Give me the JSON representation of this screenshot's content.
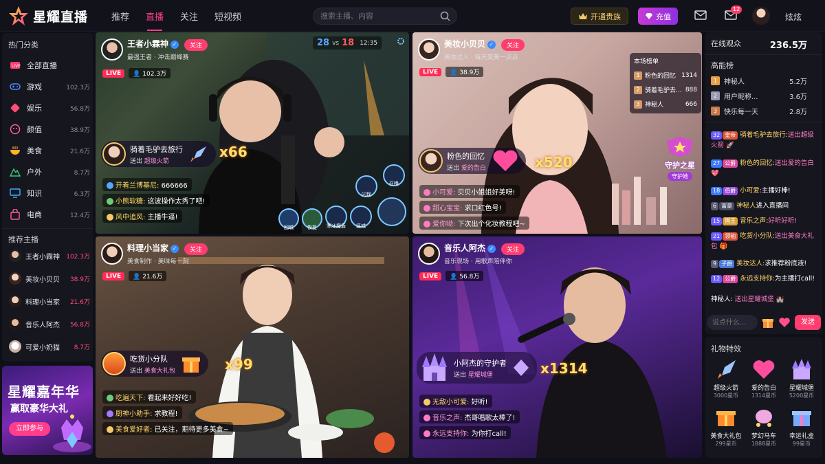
{
  "app": {
    "name": "星耀直播"
  },
  "nav": [
    "推荐",
    "直播",
    "关注",
    "短视频"
  ],
  "search": {
    "placeholder": "搜索主播、内容"
  },
  "header": {
    "vip_label": "开通贵族",
    "charge_label": "充值",
    "message_badge": "12",
    "username": "炫炫"
  },
  "sidebar": {
    "categories_title": "热门分类",
    "categories": [
      {
        "name": "全部直播",
        "count": "",
        "icon": "live-tv-icon",
        "color": "#ff3d6e"
      },
      {
        "name": "游戏",
        "count": "102.3万",
        "icon": "gamepad-icon",
        "color": "#4d8bff"
      },
      {
        "name": "娱乐",
        "count": "56.8万",
        "icon": "ticket-icon",
        "color": "#ff4d79"
      },
      {
        "name": "颜值",
        "count": "38.9万",
        "icon": "face-icon",
        "color": "#ff5fa2"
      },
      {
        "name": "美食",
        "count": "21.6万",
        "icon": "bowl-icon",
        "color": "#ffb020"
      },
      {
        "name": "户外",
        "count": "8.7万",
        "icon": "mountain-icon",
        "color": "#39c97a"
      },
      {
        "name": "知识",
        "count": "6.3万",
        "icon": "monitor-icon",
        "color": "#3ab0ff"
      },
      {
        "name": "电商",
        "count": "12.4万",
        "icon": "shopping-bag-icon",
        "color": "#ff5fa2"
      }
    ],
    "recommend_title": "推荐主播",
    "recommend": [
      {
        "name": "王者小霖神",
        "count": "102.3万"
      },
      {
        "name": "美妆小贝贝",
        "count": "38.9万"
      },
      {
        "name": "料理小当家",
        "count": "21.6万"
      },
      {
        "name": "音乐人阿杰",
        "count": "56.8万"
      },
      {
        "name": "可爱小奶猫",
        "count": "8.7万"
      }
    ]
  },
  "ad": {
    "title": "星耀嘉年华",
    "subtitle": "赢取豪华大礼",
    "button": "立即参与"
  },
  "streams": [
    {
      "name": "王者小霖神",
      "sub": "最强王者 · 冲击巅峰赛",
      "follow": "关注",
      "live": "LIVE",
      "viewers": "102.3万",
      "hud": {
        "score_left": "28",
        "vs": "vs",
        "score_right": "18",
        "time": "12:35"
      },
      "skills": [
        "回城",
        "恢复",
        "寒冰魔盾",
        "惩戒",
        "闪现",
        "召唤"
      ],
      "gift": {
        "user": "骑着毛驴去旅行",
        "action": "送出",
        "item": "超级火箭",
        "mult": "x66"
      },
      "chat": [
        {
          "u": "开着兰博基尼:",
          "t": "666666"
        },
        {
          "u": "小熊软糖:",
          "t": "这波操作太秀了吧!"
        },
        {
          "u": "风中追风:",
          "t": "主播牛逼!"
        }
      ]
    },
    {
      "name": "美妆小贝贝",
      "sub": "美妆达人 · 每天变美一点点",
      "follow": "关注",
      "live": "LIVE",
      "viewers": "38.9万",
      "rank": {
        "title": "本场榜单",
        "rows": [
          {
            "n": "1",
            "name": "粉色的回忆",
            "v": "1314"
          },
          {
            "n": "2",
            "name": "骑着毛驴去...",
            "v": "888"
          },
          {
            "n": "3",
            "name": "神秘人",
            "v": "666"
          }
        ]
      },
      "guard": {
        "title": "守护之星",
        "button": "守护她"
      },
      "gift": {
        "user": "粉色的回忆",
        "action": "送出",
        "item": "爱的告白",
        "mult": "x520"
      },
      "chat": [
        {
          "u": "小可爱:",
          "t": "贝贝小姐姐好美呀!"
        },
        {
          "u": "甜心宝宝:",
          "t": "求口红色号!"
        },
        {
          "u": "爱你呦:",
          "t": "下次出个化妆教程吧~"
        }
      ]
    },
    {
      "name": "料理小当家",
      "sub": "美食制作 · 美味每一刻",
      "follow": "关注",
      "live": "LIVE",
      "viewers": "21.6万",
      "gift": {
        "user": "吃货小分队",
        "action": "送出",
        "item": "美食大礼包",
        "mult": "x99"
      },
      "chat": [
        {
          "u": "吃遍天下:",
          "t": "看起来好好吃!"
        },
        {
          "u": "厨神小助手:",
          "t": "求教程!"
        },
        {
          "u": "美食爱好者:",
          "t": "已关注，期待更多美食~"
        }
      ]
    },
    {
      "name": "音乐人阿杰",
      "sub": "音乐现场 · 用歌声陪伴你",
      "follow": "关注",
      "live": "LIVE",
      "viewers": "56.8万",
      "gift": {
        "user": "小阿杰的守护者",
        "action": "送出",
        "item": "星耀城堡",
        "mult": "x1314"
      },
      "chat": [
        {
          "u": "无敌小可爱:",
          "t": "好听!"
        },
        {
          "u": "音乐之声:",
          "t": "杰哥唱歌太棒了!"
        },
        {
          "u": "永远支持你:",
          "t": "为你打call!"
        }
      ]
    }
  ],
  "right": {
    "online_label": "在线观众",
    "online_count": "236.5万",
    "rank_title": "高能榜",
    "rank": [
      {
        "n": "1",
        "name": "神秘人",
        "v": "5.2万"
      },
      {
        "n": "2",
        "name": "用户昵称...",
        "v": "3.6万"
      },
      {
        "n": "3",
        "name": "快乐每一天",
        "v": "2.8万"
      }
    ],
    "messages": [
      {
        "lv": "32",
        "tag": "皇帝",
        "u": "骑着毛驴去旅行:",
        "t": "送出超级火箭"
      },
      {
        "lv": "27",
        "tag": "公爵",
        "u": "粉色的回忆:",
        "t": "送出爱的告白"
      },
      {
        "lv": "18",
        "tag": "伯爵",
        "u": "小可爱:",
        "t": "主播好棒!"
      },
      {
        "lv": "6",
        "tag": "富豪",
        "u": "神秘人",
        "t": "进入直播间"
      },
      {
        "lv": "15",
        "tag": "国王",
        "u": "音乐之声:",
        "t": "好听好听!"
      },
      {
        "lv": "21",
        "tag": "领袖",
        "u": "吃货小分队:",
        "t": "送出美食大礼包"
      },
      {
        "lv": "9",
        "tag": "子爵",
        "u": "美妆达人:",
        "t": "求推荐粉底液!"
      },
      {
        "lv": "12",
        "tag": "公爵",
        "u": "永远支持你:",
        "t": "为主播打call!"
      },
      {
        "lv": "",
        "tag": "",
        "u": "神秘人:",
        "t": "送出星耀城堡"
      }
    ],
    "input_placeholder": "说点什么...",
    "send_label": "发送",
    "gifts_title": "礼物特效",
    "gifts": [
      {
        "name": "超级火箭",
        "price": "3000星币"
      },
      {
        "name": "爱的告白",
        "price": "1314星币"
      },
      {
        "name": "星耀城堡",
        "price": "5200星币"
      },
      {
        "name": "美食大礼包",
        "price": "299星币"
      },
      {
        "name": "梦幻马车",
        "price": "1888星币"
      },
      {
        "name": "幸运礼盒",
        "price": "99星币"
      }
    ]
  }
}
